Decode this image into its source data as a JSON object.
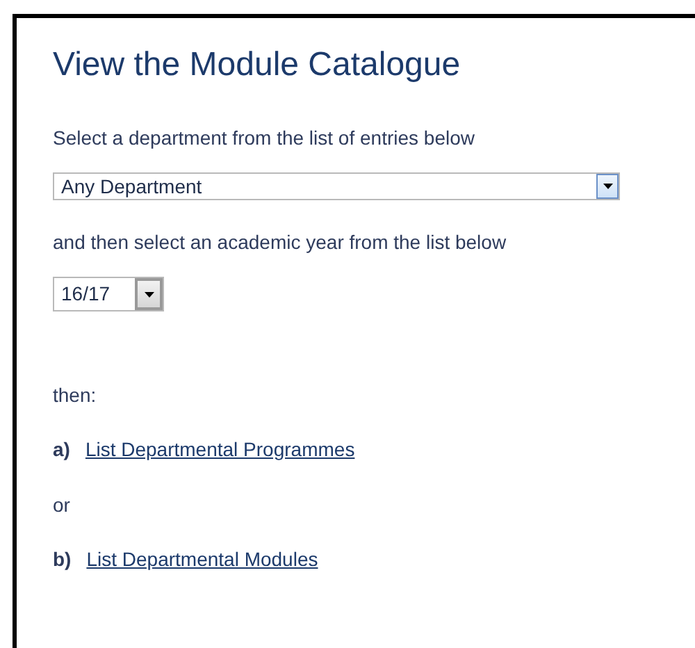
{
  "title": "View the Module Catalogue",
  "department_prompt": "Select a department from the list of entries below",
  "department_select": {
    "value": "Any Department"
  },
  "year_prompt": "and then select an academic year from the list below",
  "year_select": {
    "value": "16/17"
  },
  "then_label": "then:",
  "options": [
    {
      "letter": "a)",
      "link": "List Departmental Programmes"
    },
    {
      "letter": "b)",
      "link": "List Departmental Modules"
    }
  ],
  "or_label": "or"
}
